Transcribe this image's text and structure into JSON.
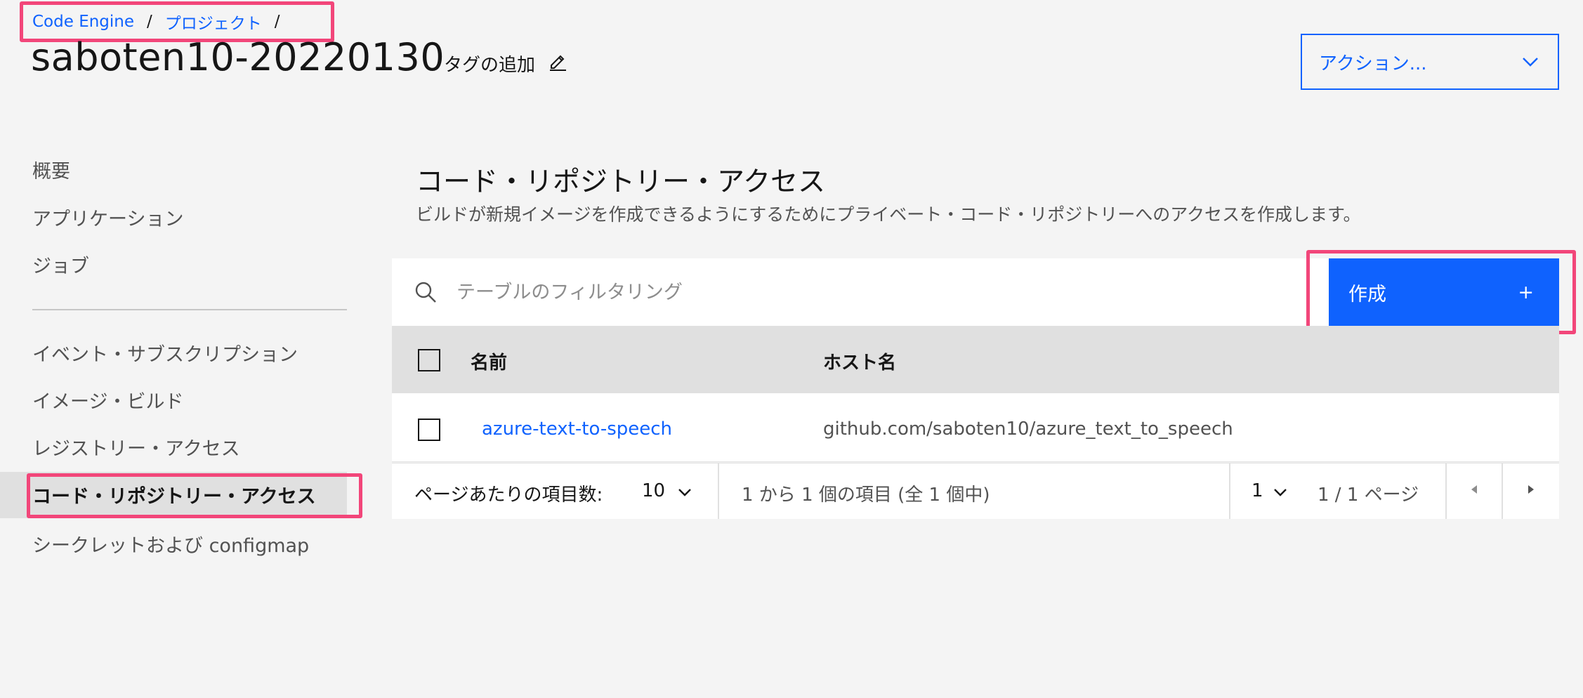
{
  "breadcrumb": {
    "items": [
      "Code Engine",
      "プロジェクト"
    ],
    "separator": "/"
  },
  "header": {
    "title": "saboten10-20220130",
    "tag_add": "タグの追加",
    "actions_label": "アクション..."
  },
  "sidebar": {
    "items": [
      {
        "label": "概要"
      },
      {
        "label": "アプリケーション"
      },
      {
        "label": "ジョブ"
      },
      {
        "label": "イベント・サブスクリプション"
      },
      {
        "label": "イメージ・ビルド"
      },
      {
        "label": "レジストリー・アクセス"
      },
      {
        "label": "コード・リポジトリー・アクセス",
        "active": true
      },
      {
        "label": "シークレットおよび configmap"
      }
    ]
  },
  "main": {
    "title": "コード・リポジトリー・アクセス",
    "description": "ビルドが新規イメージを作成できるようにするためにプライベート・コード・リポジトリーへのアクセスを作成します。",
    "search": {
      "placeholder": "テーブルのフィルタリング"
    },
    "create_label": "作成",
    "create_icon": "+",
    "table": {
      "columns": [
        "名前",
        "ホスト名"
      ],
      "rows": [
        {
          "name": "azure-text-to-speech",
          "host": "github.com/saboten10/azure_text_to_speech"
        }
      ]
    },
    "pagination": {
      "items_per_page_label": "ページあたりの項目数:",
      "items_per_page": "10",
      "range_text": "1 から 1 個の項目 (全 1 個中)",
      "page": "1",
      "page_text": "1 / 1 ページ"
    }
  },
  "colors": {
    "accent": "#0f62fe",
    "highlight": "#f2467a",
    "background": "#f4f4f4"
  }
}
